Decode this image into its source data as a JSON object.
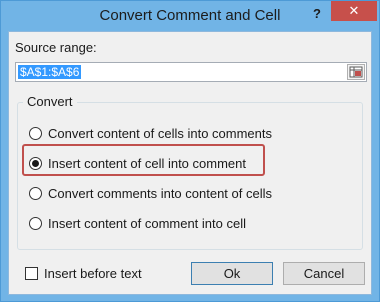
{
  "window": {
    "title": "Convert Comment and Cell",
    "help_glyph": "?",
    "close_glyph": "✕"
  },
  "source": {
    "label": "Source range:",
    "value": "$A$1:$A$6"
  },
  "convert_group": {
    "label": "Convert",
    "options": [
      {
        "label": "Convert content of cells into comments",
        "selected": false
      },
      {
        "label": "Insert content of cell into comment",
        "selected": true
      },
      {
        "label": "Convert comments into content of cells",
        "selected": false
      },
      {
        "label": "Insert content of comment into cell",
        "selected": false
      }
    ]
  },
  "insert_before_text": {
    "label": "Insert before text",
    "checked": false
  },
  "buttons": {
    "ok": "Ok",
    "cancel": "Cancel"
  },
  "colors": {
    "titlebar": "#71b4e6",
    "close_button": "#c7504b",
    "selection": "#3399ff",
    "highlight_box": "#c0504d"
  },
  "icons": {
    "range_selector": "range-select-icon"
  }
}
